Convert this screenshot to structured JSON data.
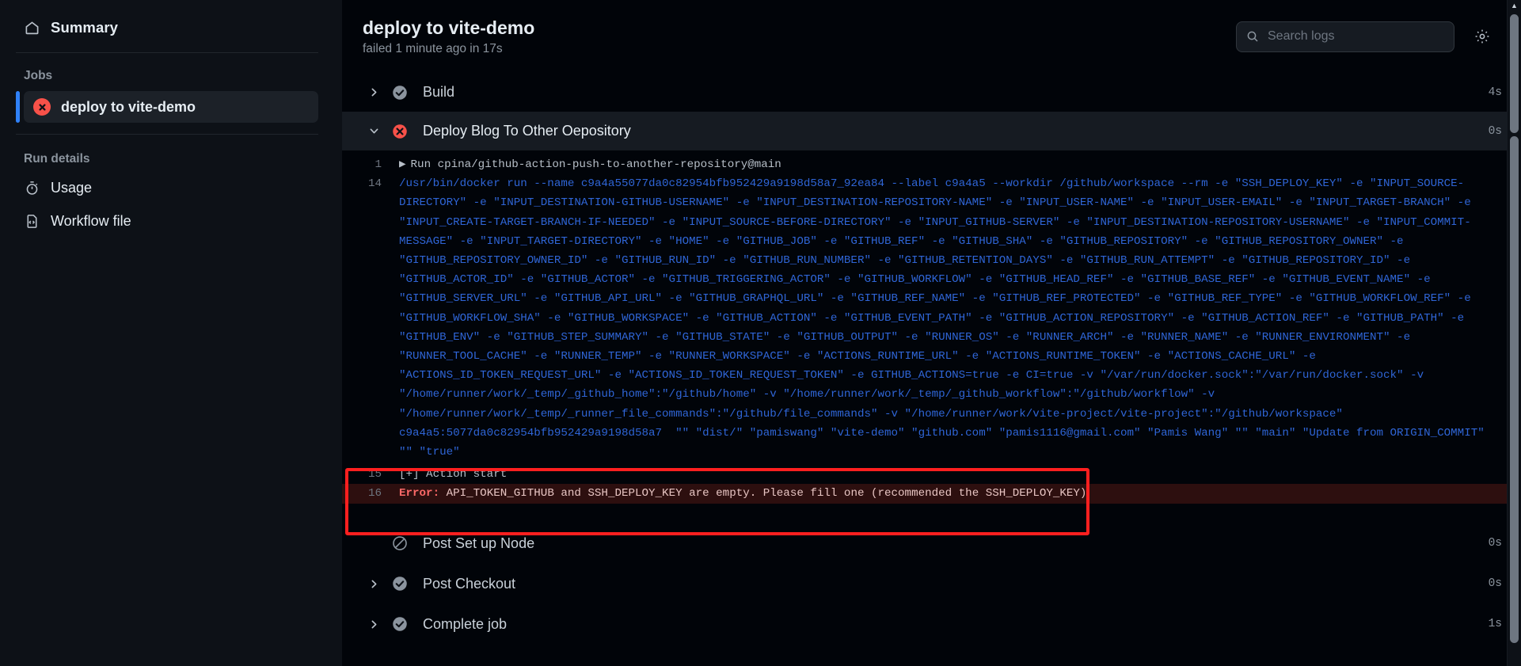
{
  "sidebar": {
    "summary": {
      "label": "Summary",
      "icon": "home-icon"
    },
    "jobs_title": "Jobs",
    "job": {
      "label": "deploy to vite-demo",
      "status": "failed",
      "icon": "x-circle-icon"
    },
    "run_details_title": "Run details",
    "links": [
      {
        "label": "Usage",
        "icon": "stopwatch-icon"
      },
      {
        "label": "Workflow file",
        "icon": "code-file-icon"
      }
    ]
  },
  "header": {
    "title": "deploy to vite-demo",
    "subtitle": "failed 1 minute ago in 17s",
    "search": {
      "placeholder": "Search logs",
      "value": "",
      "icon": "search-icon"
    },
    "settings_icon": "gear-icon"
  },
  "steps": [
    {
      "name": "Build",
      "status": "success",
      "duration": "4s",
      "expanded": false,
      "has_chevron": true
    },
    {
      "name": "Deploy Blog To Other Oepository",
      "status": "failure",
      "duration": "0s",
      "expanded": true,
      "has_chevron": true
    },
    {
      "name": "Post Set up Node",
      "status": "skipped",
      "duration": "0s",
      "expanded": false,
      "has_chevron": false
    },
    {
      "name": "Post Checkout",
      "status": "success",
      "duration": "0s",
      "expanded": false,
      "has_chevron": true
    },
    {
      "name": "Complete job",
      "status": "success",
      "duration": "1s",
      "expanded": false,
      "has_chevron": true
    }
  ],
  "log": {
    "line1": {
      "number": "1",
      "triangle": "▶",
      "text": "Run cpina/github-action-push-to-another-repository@main"
    },
    "line14": {
      "number": "14",
      "text": "/usr/bin/docker run --name c9a4a55077da0c82954bfb952429a9198d58a7_92ea84 --label c9a4a5 --workdir /github/workspace --rm -e \"SSH_DEPLOY_KEY\" -e \"INPUT_SOURCE-DIRECTORY\" -e \"INPUT_DESTINATION-GITHUB-USERNAME\" -e \"INPUT_DESTINATION-REPOSITORY-NAME\" -e \"INPUT_USER-NAME\" -e \"INPUT_USER-EMAIL\" -e \"INPUT_TARGET-BRANCH\" -e \"INPUT_CREATE-TARGET-BRANCH-IF-NEEDED\" -e \"INPUT_SOURCE-BEFORE-DIRECTORY\" -e \"INPUT_GITHUB-SERVER\" -e \"INPUT_DESTINATION-REPOSITORY-USERNAME\" -e \"INPUT_COMMIT-MESSAGE\" -e \"INPUT_TARGET-DIRECTORY\" -e \"HOME\" -e \"GITHUB_JOB\" -e \"GITHUB_REF\" -e \"GITHUB_SHA\" -e \"GITHUB_REPOSITORY\" -e \"GITHUB_REPOSITORY_OWNER\" -e \"GITHUB_REPOSITORY_OWNER_ID\" -e \"GITHUB_RUN_ID\" -e \"GITHUB_RUN_NUMBER\" -e \"GITHUB_RETENTION_DAYS\" -e \"GITHUB_RUN_ATTEMPT\" -e \"GITHUB_REPOSITORY_ID\" -e \"GITHUB_ACTOR_ID\" -e \"GITHUB_ACTOR\" -e \"GITHUB_TRIGGERING_ACTOR\" -e \"GITHUB_WORKFLOW\" -e \"GITHUB_HEAD_REF\" -e \"GITHUB_BASE_REF\" -e \"GITHUB_EVENT_NAME\" -e \"GITHUB_SERVER_URL\" -e \"GITHUB_API_URL\" -e \"GITHUB_GRAPHQL_URL\" -e \"GITHUB_REF_NAME\" -e \"GITHUB_REF_PROTECTED\" -e \"GITHUB_REF_TYPE\" -e \"GITHUB_WORKFLOW_REF\" -e \"GITHUB_WORKFLOW_SHA\" -e \"GITHUB_WORKSPACE\" -e \"GITHUB_ACTION\" -e \"GITHUB_EVENT_PATH\" -e \"GITHUB_ACTION_REPOSITORY\" -e \"GITHUB_ACTION_REF\" -e \"GITHUB_PATH\" -e \"GITHUB_ENV\" -e \"GITHUB_STEP_SUMMARY\" -e \"GITHUB_STATE\" -e \"GITHUB_OUTPUT\" -e \"RUNNER_OS\" -e \"RUNNER_ARCH\" -e \"RUNNER_NAME\" -e \"RUNNER_ENVIRONMENT\" -e \"RUNNER_TOOL_CACHE\" -e \"RUNNER_TEMP\" -e \"RUNNER_WORKSPACE\" -e \"ACTIONS_RUNTIME_URL\" -e \"ACTIONS_RUNTIME_TOKEN\" -e \"ACTIONS_CACHE_URL\" -e \"ACTIONS_ID_TOKEN_REQUEST_URL\" -e \"ACTIONS_ID_TOKEN_REQUEST_TOKEN\" -e GITHUB_ACTIONS=true -e CI=true -v \"/var/run/docker.sock\":\"/var/run/docker.sock\" -v \"/home/runner/work/_temp/_github_home\":\"/github/home\" -v \"/home/runner/work/_temp/_github_workflow\":\"/github/workflow\" -v \"/home/runner/work/_temp/_runner_file_commands\":\"/github/file_commands\" -v \"/home/runner/work/vite-project/vite-project\":\"/github/workspace\" c9a4a5:5077da0c82954bfb952429a9198d58a7  \"\" \"dist/\" \"pamiswang\" \"vite-demo\" \"github.com\" \"pamis1116@gmail.com\" \"Pamis Wang\" \"\" \"main\" \"Update from ORIGIN_COMMIT\" \"\" \"true\""
    },
    "line15": {
      "number": "15",
      "text": "[+] Action start"
    },
    "line16": {
      "number": "16",
      "prefix": "Error:",
      "text": " API_TOKEN_GITHUB and SSH_DEPLOY_KEY are empty. Please fill one (recommended the SSH_DEPLOY_KEY)"
    }
  },
  "colors": {
    "failure": "#f85149",
    "accent": "#2f81f7",
    "command": "#2f65d6",
    "annotation": "#ff1f1f"
  }
}
